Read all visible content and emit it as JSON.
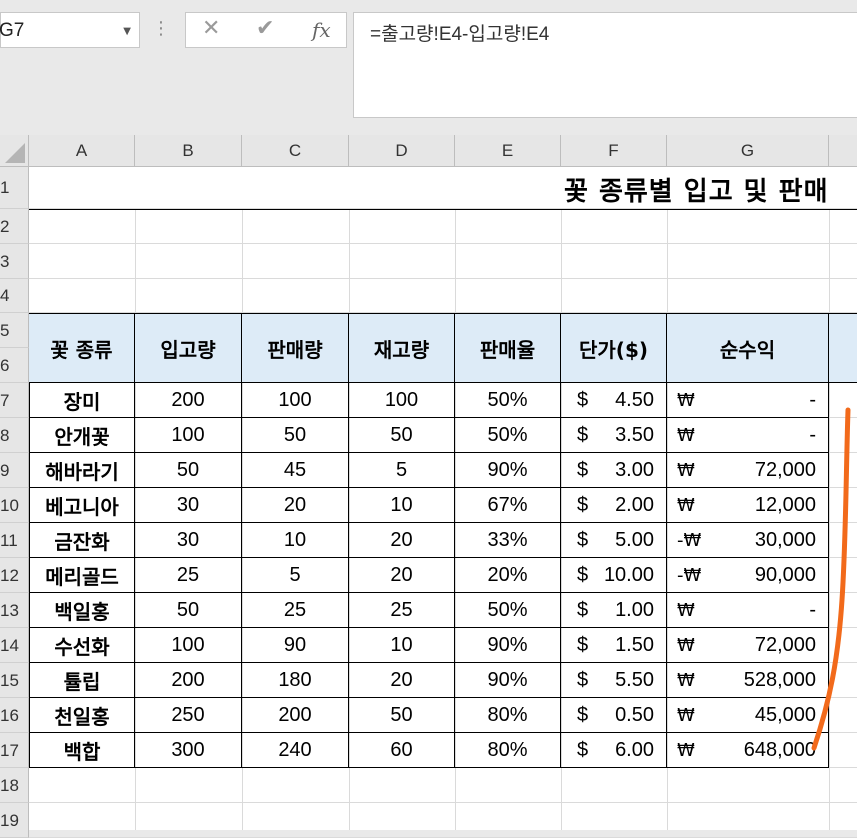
{
  "namebox": {
    "value": "G7"
  },
  "formula_bar": {
    "cancel_icon": "✕",
    "enter_icon": "✔",
    "fx_label": "fx",
    "formula": "=출고량!E4-입고량!E4"
  },
  "columns": [
    "A",
    "B",
    "C",
    "D",
    "E",
    "F",
    "G"
  ],
  "rows": [
    "1",
    "2",
    "3",
    "4",
    "5",
    "6",
    "7",
    "8",
    "9",
    "10",
    "11",
    "12",
    "13",
    "14",
    "15",
    "16",
    "17",
    "18",
    "19"
  ],
  "title": "꽃 종류별 입고 및 판매",
  "headers": [
    "꽃 종류",
    "입고량",
    "판매량",
    "재고량",
    "판매율",
    "단가($)",
    "순수익"
  ],
  "table": [
    {
      "name": "장미",
      "in": "200",
      "sold": "100",
      "stock": "100",
      "rate": "50%",
      "cur": "$",
      "price": "4.50",
      "won": "₩",
      "profit": "-"
    },
    {
      "name": "안개꽃",
      "in": "100",
      "sold": "50",
      "stock": "50",
      "rate": "50%",
      "cur": "$",
      "price": "3.50",
      "won": "₩",
      "profit": "-"
    },
    {
      "name": "해바라기",
      "in": "50",
      "sold": "45",
      "stock": "5",
      "rate": "90%",
      "cur": "$",
      "price": "3.00",
      "won": "₩",
      "profit": "72,000"
    },
    {
      "name": "베고니아",
      "in": "30",
      "sold": "20",
      "stock": "10",
      "rate": "67%",
      "cur": "$",
      "price": "2.00",
      "won": "₩",
      "profit": "12,000"
    },
    {
      "name": "금잔화",
      "in": "30",
      "sold": "10",
      "stock": "20",
      "rate": "33%",
      "cur": "$",
      "price": "5.00",
      "won": "-₩",
      "profit": "30,000"
    },
    {
      "name": "메리골드",
      "in": "25",
      "sold": "5",
      "stock": "20",
      "rate": "20%",
      "cur": "$",
      "price": "10.00",
      "won": "-₩",
      "profit": "90,000"
    },
    {
      "name": "백일홍",
      "in": "50",
      "sold": "25",
      "stock": "25",
      "rate": "50%",
      "cur": "$",
      "price": "1.00",
      "won": "₩",
      "profit": "-"
    },
    {
      "name": "수선화",
      "in": "100",
      "sold": "90",
      "stock": "10",
      "rate": "90%",
      "cur": "$",
      "price": "1.50",
      "won": "₩",
      "profit": "72,000"
    },
    {
      "name": "튤립",
      "in": "200",
      "sold": "180",
      "stock": "20",
      "rate": "90%",
      "cur": "$",
      "price": "5.50",
      "won": "₩",
      "profit": "528,000"
    },
    {
      "name": "천일홍",
      "in": "250",
      "sold": "200",
      "stock": "50",
      "rate": "80%",
      "cur": "$",
      "price": "0.50",
      "won": "₩",
      "profit": "45,000"
    },
    {
      "name": "백합",
      "in": "300",
      "sold": "240",
      "stock": "60",
      "rate": "80%",
      "cur": "$",
      "price": "6.00",
      "won": "₩",
      "profit": "648,000"
    }
  ],
  "colors": {
    "header_fill": "#ddebf7",
    "annotation_stroke": "#f26a1b"
  }
}
